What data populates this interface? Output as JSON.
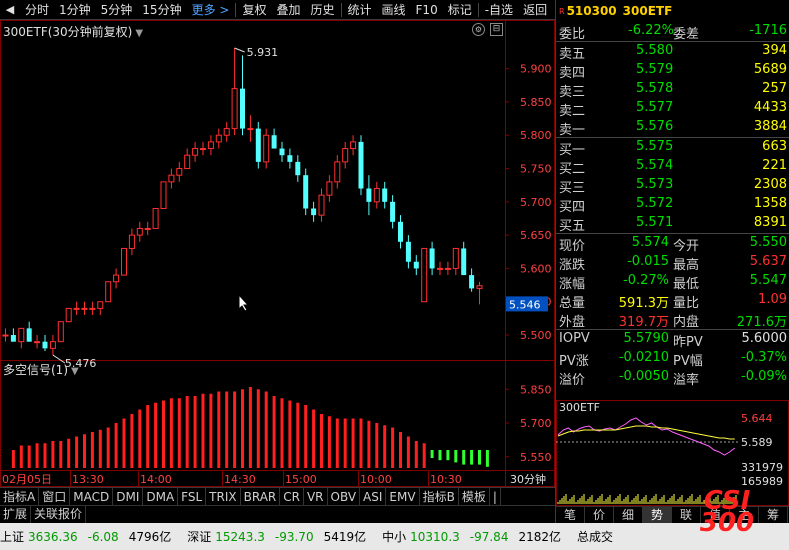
{
  "toolbar": {
    "items": [
      "分时",
      "1分钟",
      "5分钟",
      "15分钟",
      "更多 >",
      "复权",
      "叠加",
      "历史",
      "统计",
      "画线",
      "F10",
      "标记",
      "-自选",
      "返回"
    ]
  },
  "chart": {
    "title": "300ETF(30分钟前复权)",
    "indicator_title": "多空信号(1)",
    "price_axis_labels": [
      "5.900",
      "5.850",
      "5.800",
      "5.750",
      "5.700",
      "5.650",
      "5.600",
      "5.550",
      "5.500"
    ],
    "current_price_tag": "5.546",
    "high_mark": "5.931",
    "low_mark": "5.476",
    "indicator_axis_labels": [
      "5.850",
      "5.700",
      "5.550"
    ],
    "time_labels": [
      "02月05日",
      "13:30",
      "14:00",
      "14:30",
      "15:00",
      "10:00",
      "10:30"
    ],
    "period_label": "30分钟",
    "add_button": "+"
  },
  "chart_data": {
    "type": "candlestick",
    "title": "300ETF(30分钟前复权)",
    "ylim": [
      5.47,
      5.94
    ],
    "y_ticks": [
      5.5,
      5.55,
      5.6,
      5.65,
      5.7,
      5.75,
      5.8,
      5.85,
      5.9
    ],
    "candles": [
      {
        "o": 5.5,
        "h": 5.51,
        "l": 5.49,
        "c": 5.5
      },
      {
        "o": 5.5,
        "h": 5.51,
        "l": 5.49,
        "c": 5.49
      },
      {
        "o": 5.49,
        "h": 5.51,
        "l": 5.48,
        "c": 5.51
      },
      {
        "o": 5.51,
        "h": 5.52,
        "l": 5.49,
        "c": 5.49
      },
      {
        "o": 5.49,
        "h": 5.5,
        "l": 5.48,
        "c": 5.49
      },
      {
        "o": 5.49,
        "h": 5.5,
        "l": 5.476,
        "c": 5.48
      },
      {
        "o": 5.48,
        "h": 5.5,
        "l": 5.47,
        "c": 5.49
      },
      {
        "o": 5.49,
        "h": 5.52,
        "l": 5.49,
        "c": 5.52
      },
      {
        "o": 5.52,
        "h": 5.54,
        "l": 5.52,
        "c": 5.54
      },
      {
        "o": 5.54,
        "h": 5.55,
        "l": 5.53,
        "c": 5.54
      },
      {
        "o": 5.54,
        "h": 5.55,
        "l": 5.53,
        "c": 5.54
      },
      {
        "o": 5.54,
        "h": 5.55,
        "l": 5.53,
        "c": 5.54
      },
      {
        "o": 5.54,
        "h": 5.55,
        "l": 5.53,
        "c": 5.55
      },
      {
        "o": 5.55,
        "h": 5.58,
        "l": 5.55,
        "c": 5.58
      },
      {
        "o": 5.58,
        "h": 5.6,
        "l": 5.57,
        "c": 5.59
      },
      {
        "o": 5.59,
        "h": 5.63,
        "l": 5.59,
        "c": 5.63
      },
      {
        "o": 5.63,
        "h": 5.66,
        "l": 5.62,
        "c": 5.65
      },
      {
        "o": 5.65,
        "h": 5.67,
        "l": 5.64,
        "c": 5.66
      },
      {
        "o": 5.66,
        "h": 5.67,
        "l": 5.65,
        "c": 5.66
      },
      {
        "o": 5.66,
        "h": 5.69,
        "l": 5.66,
        "c": 5.69
      },
      {
        "o": 5.69,
        "h": 5.73,
        "l": 5.69,
        "c": 5.73
      },
      {
        "o": 5.73,
        "h": 5.75,
        "l": 5.72,
        "c": 5.74
      },
      {
        "o": 5.74,
        "h": 5.76,
        "l": 5.73,
        "c": 5.75
      },
      {
        "o": 5.75,
        "h": 5.78,
        "l": 5.75,
        "c": 5.77
      },
      {
        "o": 5.77,
        "h": 5.79,
        "l": 5.76,
        "c": 5.78
      },
      {
        "o": 5.78,
        "h": 5.79,
        "l": 5.77,
        "c": 5.78
      },
      {
        "o": 5.78,
        "h": 5.8,
        "l": 5.77,
        "c": 5.79
      },
      {
        "o": 5.79,
        "h": 5.81,
        "l": 5.78,
        "c": 5.8
      },
      {
        "o": 5.8,
        "h": 5.82,
        "l": 5.79,
        "c": 5.81
      },
      {
        "o": 5.81,
        "h": 5.931,
        "l": 5.8,
        "c": 5.87
      },
      {
        "o": 5.87,
        "h": 5.92,
        "l": 5.8,
        "c": 5.81
      },
      {
        "o": 5.81,
        "h": 5.83,
        "l": 5.79,
        "c": 5.81
      },
      {
        "o": 5.81,
        "h": 5.82,
        "l": 5.75,
        "c": 5.76
      },
      {
        "o": 5.76,
        "h": 5.81,
        "l": 5.75,
        "c": 5.8
      },
      {
        "o": 5.8,
        "h": 5.81,
        "l": 5.78,
        "c": 5.78
      },
      {
        "o": 5.78,
        "h": 5.79,
        "l": 5.76,
        "c": 5.77
      },
      {
        "o": 5.77,
        "h": 5.78,
        "l": 5.75,
        "c": 5.76
      },
      {
        "o": 5.76,
        "h": 5.77,
        "l": 5.73,
        "c": 5.74
      },
      {
        "o": 5.74,
        "h": 5.75,
        "l": 5.68,
        "c": 5.69
      },
      {
        "o": 5.69,
        "h": 5.7,
        "l": 5.67,
        "c": 5.68
      },
      {
        "o": 5.68,
        "h": 5.72,
        "l": 5.67,
        "c": 5.71
      },
      {
        "o": 5.71,
        "h": 5.74,
        "l": 5.7,
        "c": 5.73
      },
      {
        "o": 5.73,
        "h": 5.77,
        "l": 5.72,
        "c": 5.76
      },
      {
        "o": 5.76,
        "h": 5.79,
        "l": 5.75,
        "c": 5.78
      },
      {
        "o": 5.78,
        "h": 5.8,
        "l": 5.77,
        "c": 5.79
      },
      {
        "o": 5.79,
        "h": 5.8,
        "l": 5.71,
        "c": 5.72
      },
      {
        "o": 5.72,
        "h": 5.74,
        "l": 5.68,
        "c": 5.7
      },
      {
        "o": 5.7,
        "h": 5.73,
        "l": 5.69,
        "c": 5.72
      },
      {
        "o": 5.72,
        "h": 5.73,
        "l": 5.69,
        "c": 5.7
      },
      {
        "o": 5.7,
        "h": 5.71,
        "l": 5.66,
        "c": 5.67
      },
      {
        "o": 5.67,
        "h": 5.68,
        "l": 5.63,
        "c": 5.64
      },
      {
        "o": 5.64,
        "h": 5.65,
        "l": 5.6,
        "c": 5.61
      },
      {
        "o": 5.61,
        "h": 5.62,
        "l": 5.59,
        "c": 5.6
      },
      {
        "o": 5.55,
        "h": 5.63,
        "l": 5.55,
        "c": 5.63
      },
      {
        "o": 5.63,
        "h": 5.64,
        "l": 5.59,
        "c": 5.6
      },
      {
        "o": 5.6,
        "h": 5.61,
        "l": 5.59,
        "c": 5.6
      },
      {
        "o": 5.6,
        "h": 5.61,
        "l": 5.59,
        "c": 5.6
      },
      {
        "o": 5.6,
        "h": 5.63,
        "l": 5.59,
        "c": 5.63
      },
      {
        "o": 5.63,
        "h": 5.64,
        "l": 5.59,
        "c": 5.59
      },
      {
        "o": 5.59,
        "h": 5.6,
        "l": 5.565,
        "c": 5.57
      },
      {
        "o": 5.57,
        "h": 5.58,
        "l": 5.546,
        "c": 5.574
      }
    ],
    "indicator": {
      "name": "多空信号(1)",
      "ylim": [
        5.5,
        5.9
      ],
      "values": [
        5.58,
        5.6,
        5.6,
        5.61,
        5.61,
        5.62,
        5.62,
        5.63,
        5.64,
        5.65,
        5.66,
        5.67,
        5.68,
        5.7,
        5.72,
        5.74,
        5.76,
        5.78,
        5.79,
        5.8,
        5.81,
        5.81,
        5.82,
        5.82,
        5.83,
        5.83,
        5.84,
        5.84,
        5.84,
        5.85,
        5.86,
        5.85,
        5.84,
        5.82,
        5.81,
        5.8,
        5.79,
        5.78,
        5.76,
        5.74,
        5.73,
        5.72,
        5.72,
        5.72,
        5.72,
        5.71,
        5.7,
        5.69,
        5.68,
        5.66,
        5.64,
        5.62,
        5.61,
        5.6,
        5.59,
        5.59,
        5.58,
        5.57,
        5.57,
        5.57,
        5.56
      ],
      "signs": [
        1,
        1,
        1,
        1,
        1,
        1,
        1,
        1,
        1,
        1,
        1,
        1,
        1,
        1,
        1,
        1,
        1,
        1,
        1,
        1,
        1,
        1,
        1,
        1,
        1,
        1,
        1,
        1,
        1,
        1,
        1,
        1,
        1,
        1,
        1,
        1,
        1,
        1,
        1,
        1,
        1,
        1,
        1,
        1,
        1,
        1,
        1,
        1,
        1,
        1,
        1,
        1,
        1,
        -1,
        -1,
        -1,
        -1,
        -1,
        -1,
        -1,
        -1
      ]
    }
  },
  "indicator_tabs": [
    "指标A",
    "窗口",
    "MACD",
    "DMI",
    "DMA",
    "FSL",
    "TRIX",
    "BRAR",
    "CR",
    "VR",
    "OBV",
    "ASI",
    "EMV",
    "指标B",
    "模板",
    "|"
  ],
  "row2_tabs": [
    "扩展",
    "关联报价"
  ],
  "statusbar": [
    {
      "name": "上证",
      "price": "3636.36",
      "change": "-6.08",
      "amount": "4796亿"
    },
    {
      "name": "深证",
      "price": "15243.3",
      "change": "-93.70",
      "amount": "5419亿"
    },
    {
      "name": "中小",
      "price": "10310.3",
      "change": "-97.84",
      "amount": "2182亿"
    },
    {
      "name": "总成交",
      "price": "",
      "change": "",
      "amount": ""
    }
  ],
  "quote": {
    "tag": "R",
    "code": "510300",
    "name": "300ETF",
    "weibi_label": "委比",
    "weibi_value": "-6.22%",
    "weicha_label": "委差",
    "weicha_value": "-1716",
    "asks": [
      {
        "label": "卖五",
        "price": "5.580",
        "vol": "394"
      },
      {
        "label": "卖四",
        "price": "5.579",
        "vol": "5689"
      },
      {
        "label": "卖三",
        "price": "5.578",
        "vol": "257"
      },
      {
        "label": "卖二",
        "price": "5.577",
        "vol": "4433"
      },
      {
        "label": "卖一",
        "price": "5.576",
        "vol": "3884"
      }
    ],
    "bids": [
      {
        "label": "买一",
        "price": "5.575",
        "vol": "663"
      },
      {
        "label": "买二",
        "price": "5.574",
        "vol": "221"
      },
      {
        "label": "买三",
        "price": "5.573",
        "vol": "2308"
      },
      {
        "label": "买四",
        "price": "5.572",
        "vol": "1358"
      },
      {
        "label": "买五",
        "price": "5.571",
        "vol": "8391"
      }
    ],
    "stats": [
      {
        "l1": "现价",
        "v1": "5.574",
        "c1": "green",
        "l2": "今开",
        "v2": "5.550",
        "c2": "green"
      },
      {
        "l1": "涨跌",
        "v1": "-0.015",
        "c1": "green",
        "l2": "最高",
        "v2": "5.637",
        "c2": "red"
      },
      {
        "l1": "涨幅",
        "v1": "-0.27%",
        "c1": "green",
        "l2": "最低",
        "v2": "5.547",
        "c2": "green"
      },
      {
        "l1": "总量",
        "v1": "591.3万",
        "c1": "yellow",
        "l2": "量比",
        "v2": "1.09",
        "c2": "red"
      },
      {
        "l1": "外盘",
        "v1": "319.7万",
        "c1": "red",
        "l2": "内盘",
        "v2": "271.6万",
        "c2": "green"
      }
    ],
    "iopv": [
      {
        "l1": "IOPV",
        "v1": "5.5790",
        "c1": "green",
        "l2": "昨PV",
        "v2": "5.6000",
        "c2": "white"
      },
      {
        "l1": "PV涨",
        "v1": "-0.0210",
        "c1": "green",
        "l2": "PV幅",
        "v2": "-0.37%",
        "c2": "green"
      },
      {
        "l1": "溢价",
        "v1": "-0.0050",
        "c1": "green",
        "l2": "溢率",
        "v2": "-0.09%",
        "c2": "green"
      }
    ]
  },
  "mini_chart": {
    "title": "300ETF",
    "price_top": "5.644",
    "price_mid": "5.589",
    "vol_top": "331979",
    "vol_mid": "165989"
  },
  "right_tabs": [
    "笔",
    "价",
    "细",
    "势",
    "联",
    "值",
    "主",
    "筹"
  ],
  "active_right_tab": "势",
  "watermark": {
    "line1": "CSI",
    "line2": "300"
  }
}
